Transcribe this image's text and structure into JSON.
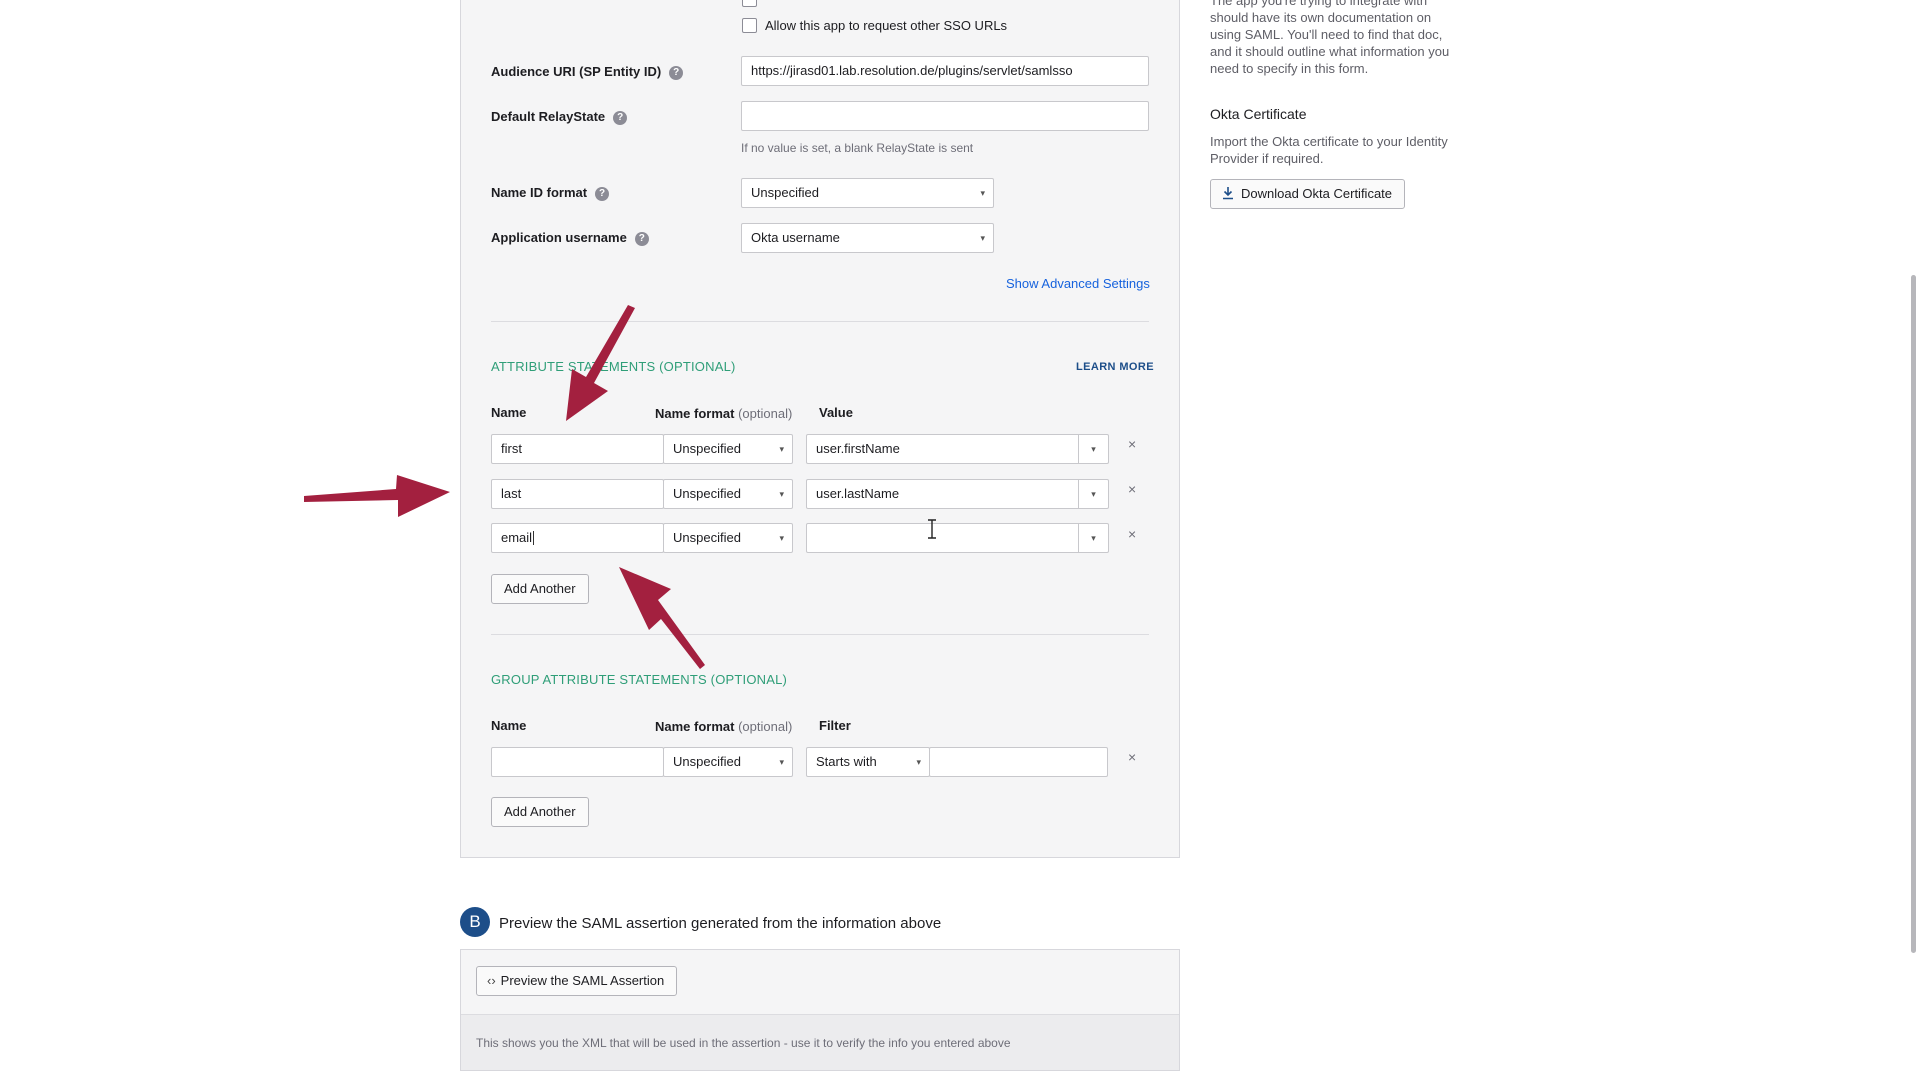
{
  "sso": {
    "allow_other_urls_label": "Allow this app to request other SSO URLs",
    "audience_label": "Audience URI (SP Entity ID)",
    "audience_value": "https://jirasd01.lab.resolution.de/plugins/servlet/samlsso",
    "relay_label": "Default RelayState",
    "relay_value": "",
    "relay_hint": "If no value is set, a blank RelayState is sent",
    "nameid_label": "Name ID format",
    "nameid_value": "Unspecified",
    "username_label": "Application username",
    "username_value": "Okta username",
    "advanced_link": "Show Advanced Settings",
    "help_glyph": "?"
  },
  "attributes": {
    "title": "ATTRIBUTE STATEMENTS (OPTIONAL)",
    "learn_more": "LEARN MORE",
    "col_name": "Name",
    "col_format": "Name format",
    "col_format_opt": "(optional)",
    "col_value": "Value",
    "rows": [
      {
        "name": "first",
        "format": "Unspecified",
        "value": "user.firstName"
      },
      {
        "name": "last",
        "format": "Unspecified",
        "value": "user.lastName"
      },
      {
        "name": "email",
        "format": "Unspecified",
        "value": ""
      }
    ],
    "add_another": "Add Another",
    "remove_glyph": "×"
  },
  "group_attributes": {
    "title": "GROUP ATTRIBUTE STATEMENTS (OPTIONAL)",
    "col_name": "Name",
    "col_format": "Name format",
    "col_format_opt": "(optional)",
    "col_filter": "Filter",
    "row": {
      "name": "",
      "format": "Unspecified",
      "filter_type": "Starts with",
      "filter_value": ""
    },
    "add_another": "Add Another",
    "remove_glyph": "×"
  },
  "sidebar": {
    "intro_lines": [
      "The app you're trying to integrate with",
      "should have its own documentation on",
      "using SAML. You'll need to find that doc,",
      "and it should outline what information you",
      "need to specify in this form."
    ],
    "cert_title": "Okta Certificate",
    "cert_lines": [
      "Import the Okta certificate to your Identity",
      "Provider if required."
    ],
    "cert_button": "Download Okta Certificate"
  },
  "preview": {
    "step_letter": "B",
    "step_text": "Preview the SAML assertion generated from the information above",
    "button_label": "Preview the SAML Assertion",
    "footer_text": "This shows you the XML that will be used in the assertion - use it to verify the info you entered above"
  },
  "icons": {
    "caret": "▾",
    "download": "download-icon",
    "code": "code-icon"
  },
  "colors": {
    "arrow": "#a3203f",
    "section_green": "#2f9e78",
    "link_blue": "#1662dd",
    "step_blue": "#1d4e89"
  }
}
